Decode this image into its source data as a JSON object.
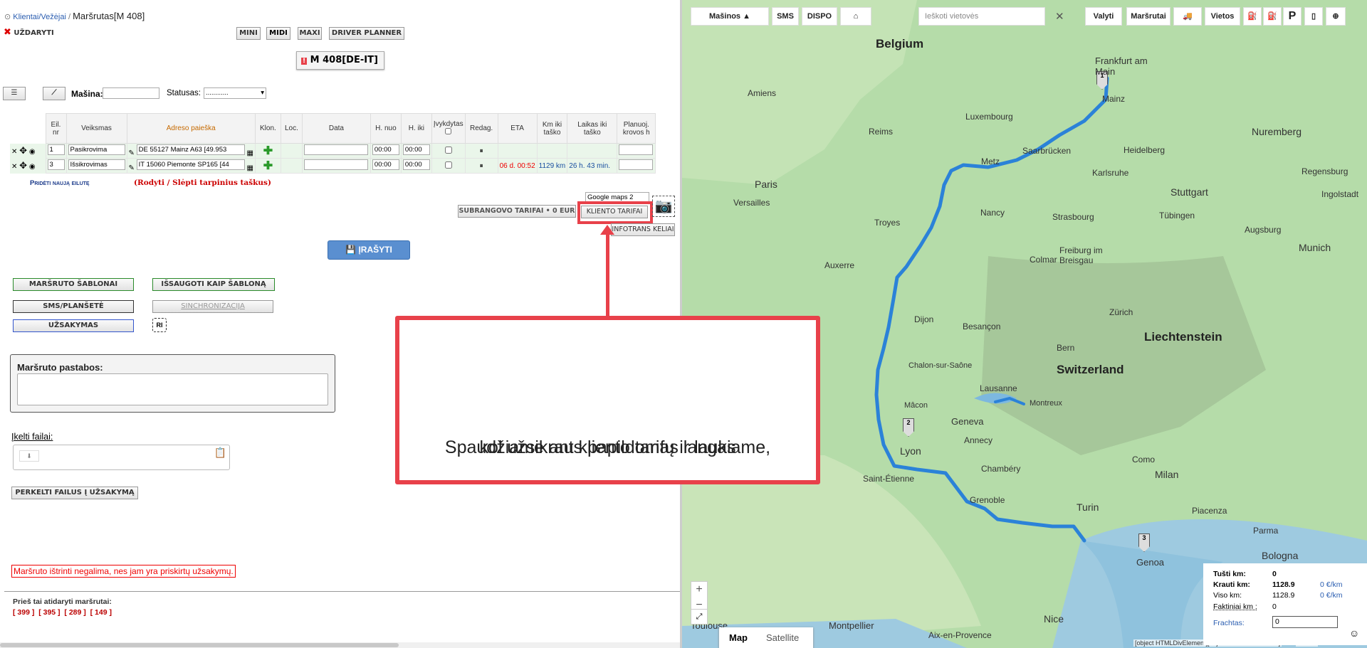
{
  "breadcrumb": {
    "link": "Klientai/Vežėjai",
    "sep": "/",
    "title": "Maršrutas[M 408]"
  },
  "toolbar": {
    "close_label": "UŽDARYTI",
    "views": [
      "MINI",
      "MIDI",
      "MAXI",
      "DRIVER PLANNER"
    ]
  },
  "route_badge": "M 408[DE-IT]",
  "filters": {
    "machine_label": "Mašina:",
    "machine_value": "",
    "status_label": "Statusas:",
    "status_value": "............"
  },
  "grid": {
    "headers": [
      "Eil. nr",
      "Veiksmas",
      "Adreso paieška",
      "Klon.",
      "Loc.",
      "Data",
      "H. nuo",
      "H. iki",
      "Įvykdytas",
      "Redag.",
      "ETA",
      "Km iki taško",
      "Laikas iki taško",
      "Planuoj. krovos h"
    ],
    "rows": [
      {
        "nr": "1",
        "action": "Pasikrovima",
        "address": "DE 55127 Mainz A63 [49.953",
        "date": "",
        "from": "00:00",
        "to": "00:00",
        "eta": "",
        "km": "",
        "time": ""
      },
      {
        "nr": "3",
        "action": "Išsikrovimas",
        "address": "IT 15060 Piemonte SP165 [44",
        "date": "",
        "from": "00:00",
        "to": "00:00",
        "eta": "06 d. 00:52",
        "km": "1129 km",
        "time": "26 h. 43 min."
      }
    ],
    "add_row": "Pridėti naują eilutę",
    "toggle_points": "(Rodyti / Slėpti tarpinius taškus)"
  },
  "map_select": "Google maps 2",
  "tariffs": {
    "sub_label": "SUBRANGOVO TARIFAI • 0 EUR",
    "client_label": "KLIENTO TARIFAI",
    "infotrans": "INFOTRANS KELIAI"
  },
  "save_label": "ĮRAŠYTI",
  "templates": {
    "route_templates": "MARŠRUTO ŠABLONAI",
    "save_template": "IŠSAUGOTI KAIP ŠABLONĄ",
    "sms": "SMS/PLANŠETĖ",
    "sync": "SINCHRONIZACIJA",
    "order": "UŽSAKYMAS",
    "ri": "RI"
  },
  "notes": {
    "label": "Maršruto pastabos:",
    "value": ""
  },
  "files": {
    "label": "Įkelti failai:",
    "move": "PERKELTI FAILUS Į UŽSAKYMĄ"
  },
  "warning": "Maršruto ištrinti negalima, nes jam yra priskirtų užsakymų.",
  "previous": {
    "label": "Prieš tai atidaryti maršrutai:",
    "ids": [
      "[ 399 ]",
      "[ 395 ]",
      "[ 289 ]",
      "[ 149 ]"
    ]
  },
  "callout": {
    "line1": "Spaudžiame ant kliento tarifų ir laukiame,",
    "line2": "kol užsikraus papildomas langas"
  },
  "map": {
    "toolbar": {
      "machines": "Mašinos",
      "sms": "SMS",
      "dispo": "DISPO",
      "search_placeholder": "Ieškoti vietovės",
      "clear": "Valyti",
      "routes": "Maršrutai",
      "places": "Vietos",
      "parking": "P"
    },
    "countries": [
      "Belgium",
      "Liechtenstein",
      "Switzerland"
    ],
    "cities": [
      "Frankfurt am Main",
      "Mainz",
      "Nuremberg",
      "Heidelberg",
      "Karlsruhe",
      "Stuttgart",
      "Tübingen",
      "Regensburg",
      "Ingolstadt",
      "Augsburg",
      "Munich",
      "Luxembourg",
      "Metz",
      "Saarbrücken",
      "Nancy",
      "Strasbourg",
      "Freiburg im Breisgau",
      "Colmar",
      "Paris",
      "Versailles",
      "Amiens",
      "Reims",
      "Troyes",
      "Auxerre",
      "Dijon",
      "Besançon",
      "Bern",
      "Zürich",
      "Chalon-sur-Saône",
      "Mâcon",
      "Lausanne",
      "Montreux",
      "Geneva",
      "Annecy",
      "Lyon",
      "Chambéry",
      "Grenoble",
      "Saint-Étienne",
      "Turin",
      "Milan",
      "Piacenza",
      "Genoa",
      "Bologna",
      "Nice",
      "Montpellier",
      "Aix-en-Provence",
      "Toulouse",
      "Como",
      "Parma"
    ],
    "type_map": "Map",
    "type_sat": "Satellite",
    "stats": {
      "empty_label": "Tušti km:",
      "empty_val": "0",
      "loaded_label": "Krauti km:",
      "loaded_val": "1128.9",
      "loaded_rate": "0 €/km",
      "total_label": "Viso km:",
      "total_val": "1128.9",
      "total_rate": "0 €/km",
      "actual_label": "Faktiniai km :",
      "actual_val": "0",
      "freight_label": "Frachtas:",
      "freight_val": "0"
    },
    "footer": "[object HTMLDivElement][object HTMLDivElement]",
    "scale": "50 km",
    "route_color": "#2b82d8"
  }
}
